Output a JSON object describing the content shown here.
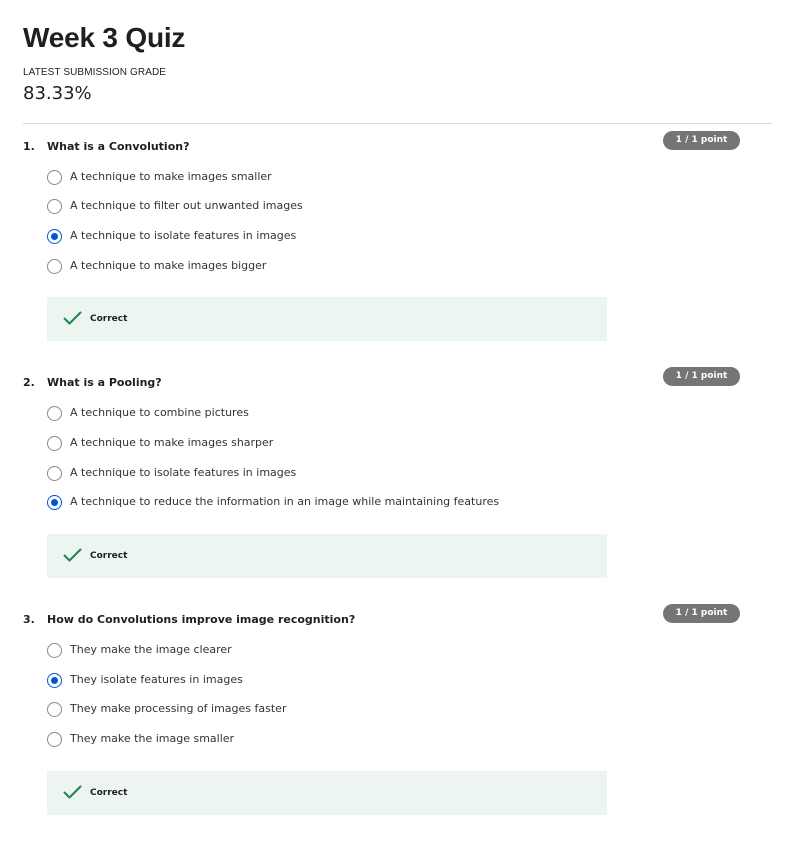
{
  "quiz": {
    "title": "Week 3 Quiz",
    "grade_label": "LATEST SUBMISSION GRADE",
    "grade_value": "83.33%"
  },
  "colors": {
    "accent": "#0056d2",
    "badge": "#757575",
    "feedback_bg": "#edf5f1",
    "check": "#1f8354"
  },
  "questions": [
    {
      "number": "1.",
      "text": "What is a Convolution?",
      "points": "1 / 1 point",
      "options": [
        {
          "label": "A technique to make images smaller",
          "selected": false
        },
        {
          "label": "A technique to filter out unwanted images",
          "selected": false
        },
        {
          "label": "A technique to isolate features in images",
          "selected": true
        },
        {
          "label": "A technique to make images bigger",
          "selected": false
        }
      ],
      "feedback": {
        "icon": "checkmark-icon",
        "text": "Correct"
      }
    },
    {
      "number": "2.",
      "text": "What is a Pooling?",
      "points": "1 / 1 point",
      "options": [
        {
          "label": "A technique to combine pictures",
          "selected": false
        },
        {
          "label": "A technique to make images sharper",
          "selected": false
        },
        {
          "label": "A technique to isolate features in images",
          "selected": false
        },
        {
          "label": "A technique to reduce the information in an image while maintaining features",
          "selected": true
        }
      ],
      "feedback": {
        "icon": "checkmark-icon",
        "text": "Correct"
      }
    },
    {
      "number": "3.",
      "text": "How do Convolutions improve image recognition?",
      "points": "1 / 1 point",
      "options": [
        {
          "label": "They make the image clearer",
          "selected": false
        },
        {
          "label": "They isolate features in images",
          "selected": true
        },
        {
          "label": "They make processing of images faster",
          "selected": false
        },
        {
          "label": "They make the image smaller",
          "selected": false
        }
      ],
      "feedback": {
        "icon": "checkmark-icon",
        "text": "Correct"
      }
    }
  ]
}
